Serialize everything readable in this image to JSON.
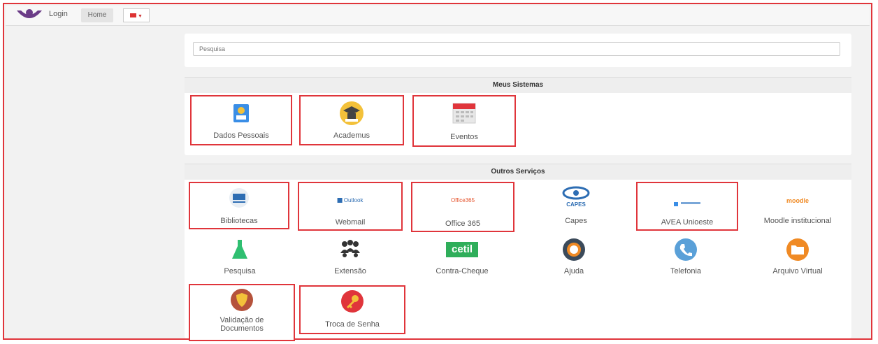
{
  "topbar": {
    "login": "Login",
    "home": "Home",
    "lang": "▼"
  },
  "search": {
    "placeholder": "Pesquisa"
  },
  "sections": {
    "meus": {
      "title": "Meus Sistemas",
      "items": [
        {
          "label": "Dados Pessoais",
          "icon": "profile-card-icon"
        },
        {
          "label": "Academus",
          "icon": "graduation-cap-icon"
        },
        {
          "label": "Eventos",
          "icon": "calendar-icon"
        }
      ]
    },
    "outros": {
      "title": "Outros Serviços",
      "items": [
        {
          "label": "Bibliotecas",
          "icon": "library-logo-icon"
        },
        {
          "label": "Webmail",
          "icon": "outlook-logo-icon",
          "logo_text": "Outlook"
        },
        {
          "label": "Office 365",
          "icon": "office-logo-icon",
          "logo_text": "Office365"
        },
        {
          "label": "Capes",
          "icon": "capes-logo-icon",
          "logo_text": "CAPES"
        },
        {
          "label": "AVEA Unioeste",
          "icon": "avea-logo-icon"
        },
        {
          "label": "Moodle institucional",
          "icon": "moodle-logo-icon",
          "logo_text": "moodle"
        },
        {
          "label": "Pesquisa",
          "icon": "flask-icon"
        },
        {
          "label": "Extensão",
          "icon": "people-group-icon"
        },
        {
          "label": "Contra-Cheque",
          "icon": "cetil-logo-icon",
          "logo_text": "cetil"
        },
        {
          "label": "Ajuda",
          "icon": "lifebuoy-icon"
        },
        {
          "label": "Telefonia",
          "icon": "phone-icon"
        },
        {
          "label": "Arquivo Virtual",
          "icon": "folder-icon"
        },
        {
          "label": "Validação de Documentos",
          "icon": "shield-icon"
        },
        {
          "label": "Troca de Senha",
          "icon": "key-icon"
        }
      ]
    }
  },
  "colors": {
    "highlight": "#e0353b",
    "blue": "#3a8ee6",
    "yellow": "#f3c13a",
    "green": "#2fbf71",
    "brown": "#b5523b",
    "orange": "#f08a24"
  }
}
